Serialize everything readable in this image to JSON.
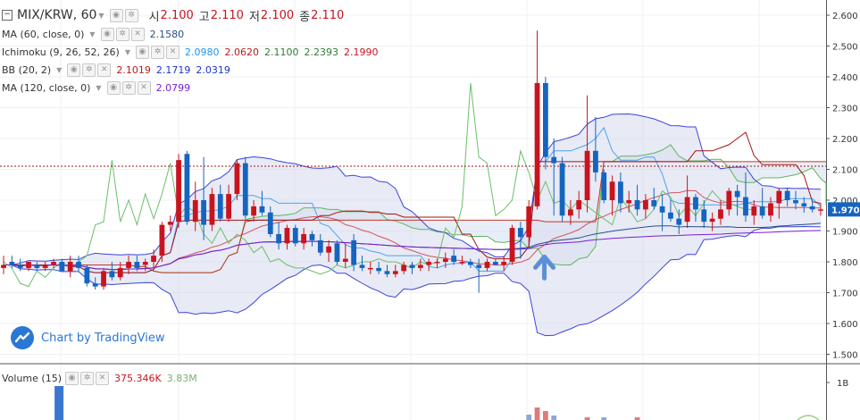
{
  "symbol": {
    "title": "MIX/KRW, 60",
    "open_label": "시",
    "open": "2.100",
    "high_label": "고",
    "high": "2.110",
    "low_label": "저",
    "low": "2.100",
    "close_label": "종",
    "close": "2.110"
  },
  "indicators": [
    {
      "name": "MA (60, close, 0)",
      "values": [
        "2.1580"
      ],
      "colors": [
        "#2a4f86"
      ]
    },
    {
      "name": "Ichimoku (9, 26, 52, 26)",
      "values": [
        "2.0980",
        "2.0620",
        "2.1100",
        "2.2393",
        "2.1990"
      ],
      "colors": [
        "#2196f3",
        "#b71c1c",
        "#2e7d32",
        "#2e7d32",
        "#c8141e"
      ]
    },
    {
      "name": "BB (20, 2)",
      "values": [
        "2.1019",
        "2.1719",
        "2.0319"
      ],
      "colors": [
        "#b71c1c",
        "#1e35c8",
        "#1e35c8"
      ]
    },
    {
      "name": "MA (120, close, 0)",
      "values": [
        "2.0799"
      ],
      "colors": [
        "#7a1fd6"
      ]
    }
  ],
  "volume": {
    "name": "Volume (15)",
    "values": [
      "375.346K",
      "3.83M"
    ],
    "colors": [
      "#c8141e",
      "#7bb06e"
    ],
    "axis_label": "1B"
  },
  "watermark": "Chart by TradingView",
  "price_axis": {
    "ticks": [
      "2.600",
      "2.500",
      "2.400",
      "2.300",
      "2.200",
      "2.100",
      "2.000",
      "1.900",
      "1.800",
      "1.700",
      "1.600",
      "1.500"
    ],
    "last_price": "1.970",
    "last_price_color": "#1565c0"
  },
  "colors": {
    "up": "#c8141e",
    "down": "#1565c0",
    "cloud": "#d5e0f0",
    "bb_band": "#d9dcef"
  },
  "chart_data": {
    "type": "candlestick",
    "ylim": [
      1.475,
      2.625
    ],
    "ticks": [
      2.6,
      2.5,
      2.4,
      2.3,
      2.2,
      2.1,
      2.0,
      1.9,
      1.8,
      1.7,
      1.6,
      1.5
    ],
    "last_price": 1.97,
    "reference_line": 2.11,
    "candles": [
      {
        "o": 1.78,
        "h": 1.82,
        "l": 1.76,
        "c": 1.79
      },
      {
        "o": 1.8,
        "h": 1.82,
        "l": 1.78,
        "c": 1.79
      },
      {
        "o": 1.79,
        "h": 1.81,
        "l": 1.77,
        "c": 1.78
      },
      {
        "o": 1.78,
        "h": 1.8,
        "l": 1.77,
        "c": 1.8
      },
      {
        "o": 1.79,
        "h": 1.8,
        "l": 1.77,
        "c": 1.78
      },
      {
        "o": 1.78,
        "h": 1.8,
        "l": 1.77,
        "c": 1.79
      },
      {
        "o": 1.79,
        "h": 1.81,
        "l": 1.78,
        "c": 1.8
      },
      {
        "o": 1.8,
        "h": 1.81,
        "l": 1.77,
        "c": 1.77
      },
      {
        "o": 1.77,
        "h": 1.82,
        "l": 1.75,
        "c": 1.8
      },
      {
        "o": 1.8,
        "h": 1.82,
        "l": 1.77,
        "c": 1.78
      },
      {
        "o": 1.78,
        "h": 1.79,
        "l": 1.72,
        "c": 1.73
      },
      {
        "o": 1.73,
        "h": 1.75,
        "l": 1.71,
        "c": 1.72
      },
      {
        "o": 1.72,
        "h": 1.78,
        "l": 1.71,
        "c": 1.77
      },
      {
        "o": 1.77,
        "h": 1.8,
        "l": 1.74,
        "c": 1.75
      },
      {
        "o": 1.75,
        "h": 1.8,
        "l": 1.74,
        "c": 1.78
      },
      {
        "o": 1.78,
        "h": 1.82,
        "l": 1.76,
        "c": 1.8
      },
      {
        "o": 1.8,
        "h": 1.82,
        "l": 1.77,
        "c": 1.78
      },
      {
        "o": 1.79,
        "h": 1.81,
        "l": 1.77,
        "c": 1.8
      },
      {
        "o": 1.8,
        "h": 1.84,
        "l": 1.78,
        "c": 1.82
      },
      {
        "o": 1.82,
        "h": 1.93,
        "l": 1.8,
        "c": 1.92
      },
      {
        "o": 1.92,
        "h": 1.95,
        "l": 1.9,
        "c": 1.93
      },
      {
        "o": 1.93,
        "h": 2.15,
        "l": 1.91,
        "c": 2.13
      },
      {
        "o": 2.15,
        "h": 2.16,
        "l": 1.92,
        "c": 1.93
      },
      {
        "o": 1.93,
        "h": 2.06,
        "l": 1.9,
        "c": 2.0
      },
      {
        "o": 2.0,
        "h": 2.14,
        "l": 1.87,
        "c": 1.92
      },
      {
        "o": 1.92,
        "h": 2.04,
        "l": 1.9,
        "c": 2.02
      },
      {
        "o": 2.02,
        "h": 2.05,
        "l": 1.93,
        "c": 1.94
      },
      {
        "o": 1.94,
        "h": 2.05,
        "l": 1.93,
        "c": 2.02
      },
      {
        "o": 2.02,
        "h": 2.13,
        "l": 2.0,
        "c": 2.12
      },
      {
        "o": 2.12,
        "h": 2.14,
        "l": 1.94,
        "c": 1.95
      },
      {
        "o": 1.95,
        "h": 2.0,
        "l": 1.93,
        "c": 1.98
      },
      {
        "o": 1.98,
        "h": 2.03,
        "l": 1.95,
        "c": 1.96
      },
      {
        "o": 1.96,
        "h": 1.98,
        "l": 1.88,
        "c": 1.89
      },
      {
        "o": 1.89,
        "h": 1.93,
        "l": 1.84,
        "c": 1.86
      },
      {
        "o": 1.86,
        "h": 1.92,
        "l": 1.84,
        "c": 1.91
      },
      {
        "o": 1.91,
        "h": 1.92,
        "l": 1.85,
        "c": 1.86
      },
      {
        "o": 1.86,
        "h": 1.91,
        "l": 1.84,
        "c": 1.89
      },
      {
        "o": 1.89,
        "h": 1.9,
        "l": 1.85,
        "c": 1.87
      },
      {
        "o": 1.87,
        "h": 1.89,
        "l": 1.82,
        "c": 1.83
      },
      {
        "o": 1.83,
        "h": 1.87,
        "l": 1.8,
        "c": 1.85
      },
      {
        "o": 1.86,
        "h": 1.87,
        "l": 1.79,
        "c": 1.8
      },
      {
        "o": 1.8,
        "h": 1.86,
        "l": 1.78,
        "c": 1.81
      },
      {
        "o": 1.87,
        "h": 1.89,
        "l": 1.77,
        "c": 1.79
      },
      {
        "o": 1.79,
        "h": 1.82,
        "l": 1.77,
        "c": 1.78
      },
      {
        "o": 1.78,
        "h": 1.8,
        "l": 1.76,
        "c": 1.78
      },
      {
        "o": 1.78,
        "h": 1.8,
        "l": 1.76,
        "c": 1.77
      },
      {
        "o": 1.77,
        "h": 1.79,
        "l": 1.75,
        "c": 1.76
      },
      {
        "o": 1.76,
        "h": 1.79,
        "l": 1.75,
        "c": 1.77
      },
      {
        "o": 1.77,
        "h": 1.8,
        "l": 1.76,
        "c": 1.79
      },
      {
        "o": 1.79,
        "h": 1.8,
        "l": 1.76,
        "c": 1.78
      },
      {
        "o": 1.78,
        "h": 1.81,
        "l": 1.77,
        "c": 1.79
      },
      {
        "o": 1.79,
        "h": 1.81,
        "l": 1.77,
        "c": 1.8
      },
      {
        "o": 1.8,
        "h": 1.81,
        "l": 1.78,
        "c": 1.8
      },
      {
        "o": 1.8,
        "h": 1.83,
        "l": 1.78,
        "c": 1.81
      },
      {
        "o": 1.82,
        "h": 1.84,
        "l": 1.79,
        "c": 1.8
      },
      {
        "o": 1.8,
        "h": 1.82,
        "l": 1.79,
        "c": 1.8
      },
      {
        "o": 1.8,
        "h": 1.81,
        "l": 1.78,
        "c": 1.79
      },
      {
        "o": 1.79,
        "h": 1.81,
        "l": 1.7,
        "c": 1.78
      },
      {
        "o": 1.78,
        "h": 1.81,
        "l": 1.77,
        "c": 1.8
      },
      {
        "o": 1.8,
        "h": 1.81,
        "l": 1.79,
        "c": 1.79
      },
      {
        "o": 1.79,
        "h": 1.82,
        "l": 1.77,
        "c": 1.8
      },
      {
        "o": 1.8,
        "h": 1.92,
        "l": 1.79,
        "c": 1.91
      },
      {
        "o": 1.91,
        "h": 1.93,
        "l": 1.81,
        "c": 1.88
      },
      {
        "o": 1.88,
        "h": 2.0,
        "l": 1.85,
        "c": 1.98
      },
      {
        "o": 1.98,
        "h": 2.55,
        "l": 1.97,
        "c": 2.38
      },
      {
        "o": 2.38,
        "h": 2.4,
        "l": 2.1,
        "c": 2.14
      },
      {
        "o": 2.14,
        "h": 2.2,
        "l": 1.95,
        "c": 2.12
      },
      {
        "o": 2.12,
        "h": 2.14,
        "l": 1.93,
        "c": 1.95
      },
      {
        "o": 1.95,
        "h": 2.0,
        "l": 1.92,
        "c": 1.97
      },
      {
        "o": 1.97,
        "h": 2.03,
        "l": 1.94,
        "c": 2.0
      },
      {
        "o": 2.0,
        "h": 2.34,
        "l": 1.96,
        "c": 2.16
      },
      {
        "o": 2.16,
        "h": 2.27,
        "l": 2.06,
        "c": 2.09
      },
      {
        "o": 2.09,
        "h": 2.1,
        "l": 1.99,
        "c": 2.0
      },
      {
        "o": 2.0,
        "h": 2.08,
        "l": 1.95,
        "c": 2.06
      },
      {
        "o": 2.06,
        "h": 2.09,
        "l": 1.96,
        "c": 1.99
      },
      {
        "o": 1.99,
        "h": 2.03,
        "l": 1.96,
        "c": 2.0
      },
      {
        "o": 2.0,
        "h": 2.05,
        "l": 1.95,
        "c": 1.97
      },
      {
        "o": 1.97,
        "h": 2.02,
        "l": 1.94,
        "c": 2.0
      },
      {
        "o": 2.0,
        "h": 2.04,
        "l": 1.97,
        "c": 1.98
      },
      {
        "o": 1.98,
        "h": 2.02,
        "l": 1.9,
        "c": 1.96
      },
      {
        "o": 1.96,
        "h": 2.0,
        "l": 1.93,
        "c": 1.94
      },
      {
        "o": 1.94,
        "h": 1.97,
        "l": 1.89,
        "c": 1.92
      },
      {
        "o": 1.93,
        "h": 2.08,
        "l": 1.91,
        "c": 2.01
      },
      {
        "o": 2.01,
        "h": 2.02,
        "l": 1.93,
        "c": 1.97
      },
      {
        "o": 1.97,
        "h": 2.0,
        "l": 1.91,
        "c": 1.93
      },
      {
        "o": 1.93,
        "h": 1.96,
        "l": 1.9,
        "c": 1.94
      },
      {
        "o": 1.94,
        "h": 2.0,
        "l": 1.92,
        "c": 1.97
      },
      {
        "o": 1.97,
        "h": 2.04,
        "l": 1.95,
        "c": 2.03
      },
      {
        "o": 2.03,
        "h": 2.05,
        "l": 1.95,
        "c": 2.01
      },
      {
        "o": 2.01,
        "h": 2.09,
        "l": 1.93,
        "c": 1.95
      },
      {
        "o": 1.95,
        "h": 2.0,
        "l": 1.92,
        "c": 1.98
      },
      {
        "o": 1.98,
        "h": 2.04,
        "l": 1.94,
        "c": 1.95
      },
      {
        "o": 1.95,
        "h": 2.01,
        "l": 1.93,
        "c": 1.99
      },
      {
        "o": 1.99,
        "h": 2.04,
        "l": 1.94,
        "c": 2.03
      },
      {
        "o": 2.03,
        "h": 2.04,
        "l": 1.98,
        "c": 2.0
      },
      {
        "o": 2.0,
        "h": 2.03,
        "l": 1.97,
        "c": 1.99
      },
      {
        "o": 1.99,
        "h": 2.01,
        "l": 1.96,
        "c": 1.98
      },
      {
        "o": 1.98,
        "h": 2.0,
        "l": 1.96,
        "c": 1.97
      },
      {
        "o": 1.97,
        "h": 1.99,
        "l": 1.95,
        "c": 1.97
      }
    ]
  }
}
